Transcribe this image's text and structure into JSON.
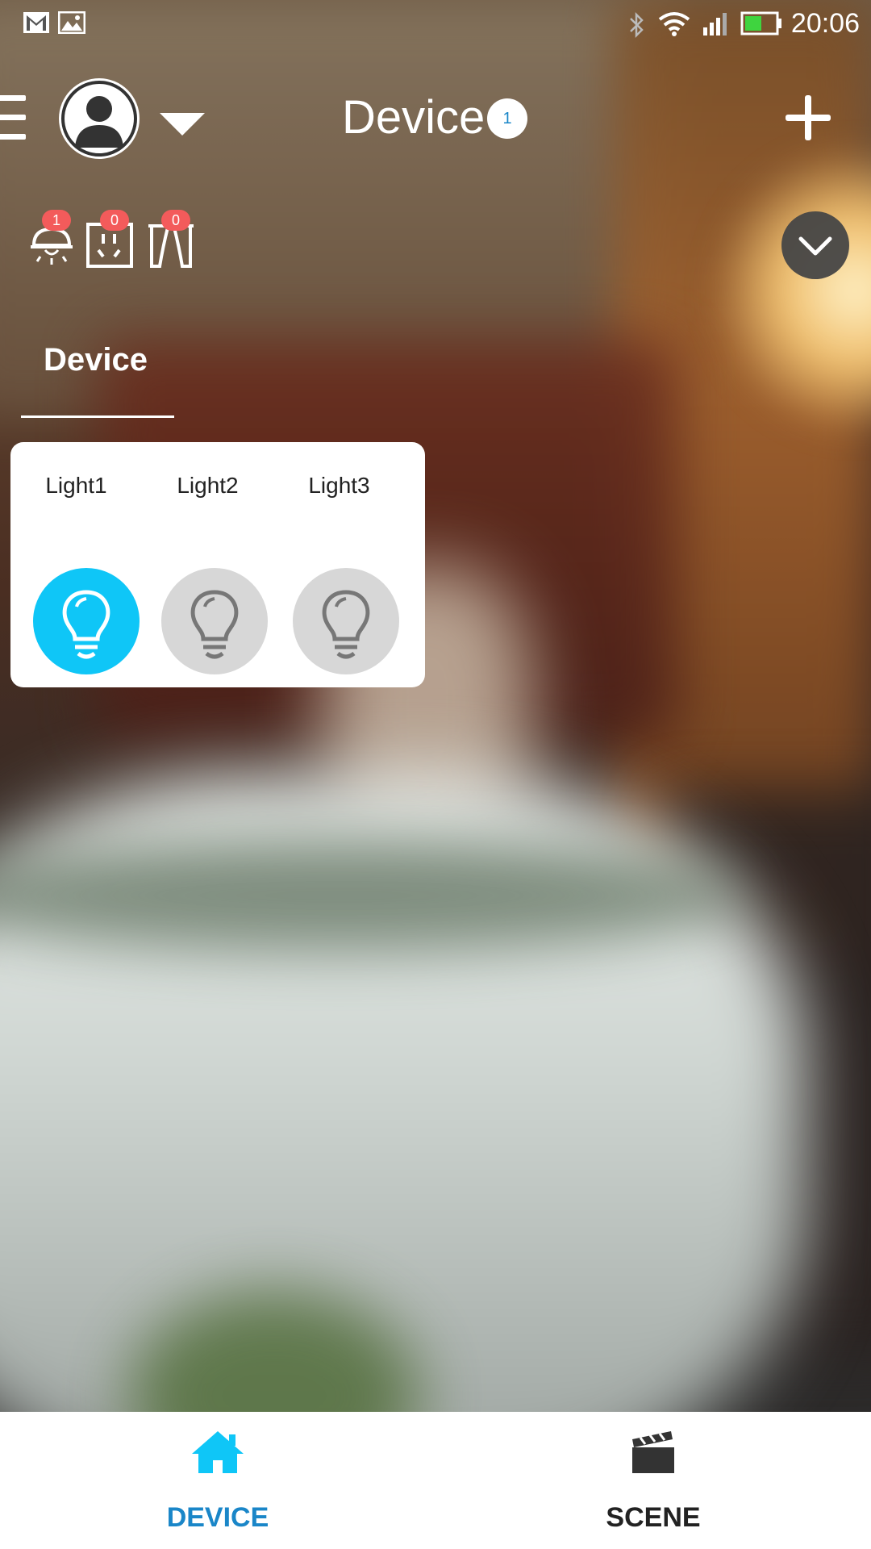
{
  "status_bar": {
    "time": "20:06",
    "icons": [
      "gmail-icon",
      "image-icon",
      "bluetooth-icon",
      "wifi-icon",
      "signal-icon",
      "battery-icon"
    ]
  },
  "header": {
    "title": "Device",
    "title_badge": "1",
    "icons": [
      "menu-icon",
      "avatar",
      "chevron-down-icon",
      "add-icon"
    ]
  },
  "categories": [
    {
      "name": "ceiling-light",
      "count": "1"
    },
    {
      "name": "socket",
      "count": "0"
    },
    {
      "name": "curtain",
      "count": "0"
    }
  ],
  "section_tab": {
    "label": "Device"
  },
  "devices": [
    {
      "name": "Light1",
      "state": "on"
    },
    {
      "name": "Light2",
      "state": "off"
    },
    {
      "name": "Light3",
      "state": "off"
    }
  ],
  "bottom_nav": {
    "items": [
      {
        "label": "DEVICE",
        "icon": "home-icon",
        "active": true
      },
      {
        "label": "SCENE",
        "icon": "clapperboard-icon",
        "active": false
      }
    ]
  },
  "colors": {
    "accent": "#0fc6f7",
    "active_nav": "#1a86c8",
    "badge": "#f35b5b",
    "bulb_off": "#d7d7d7"
  }
}
